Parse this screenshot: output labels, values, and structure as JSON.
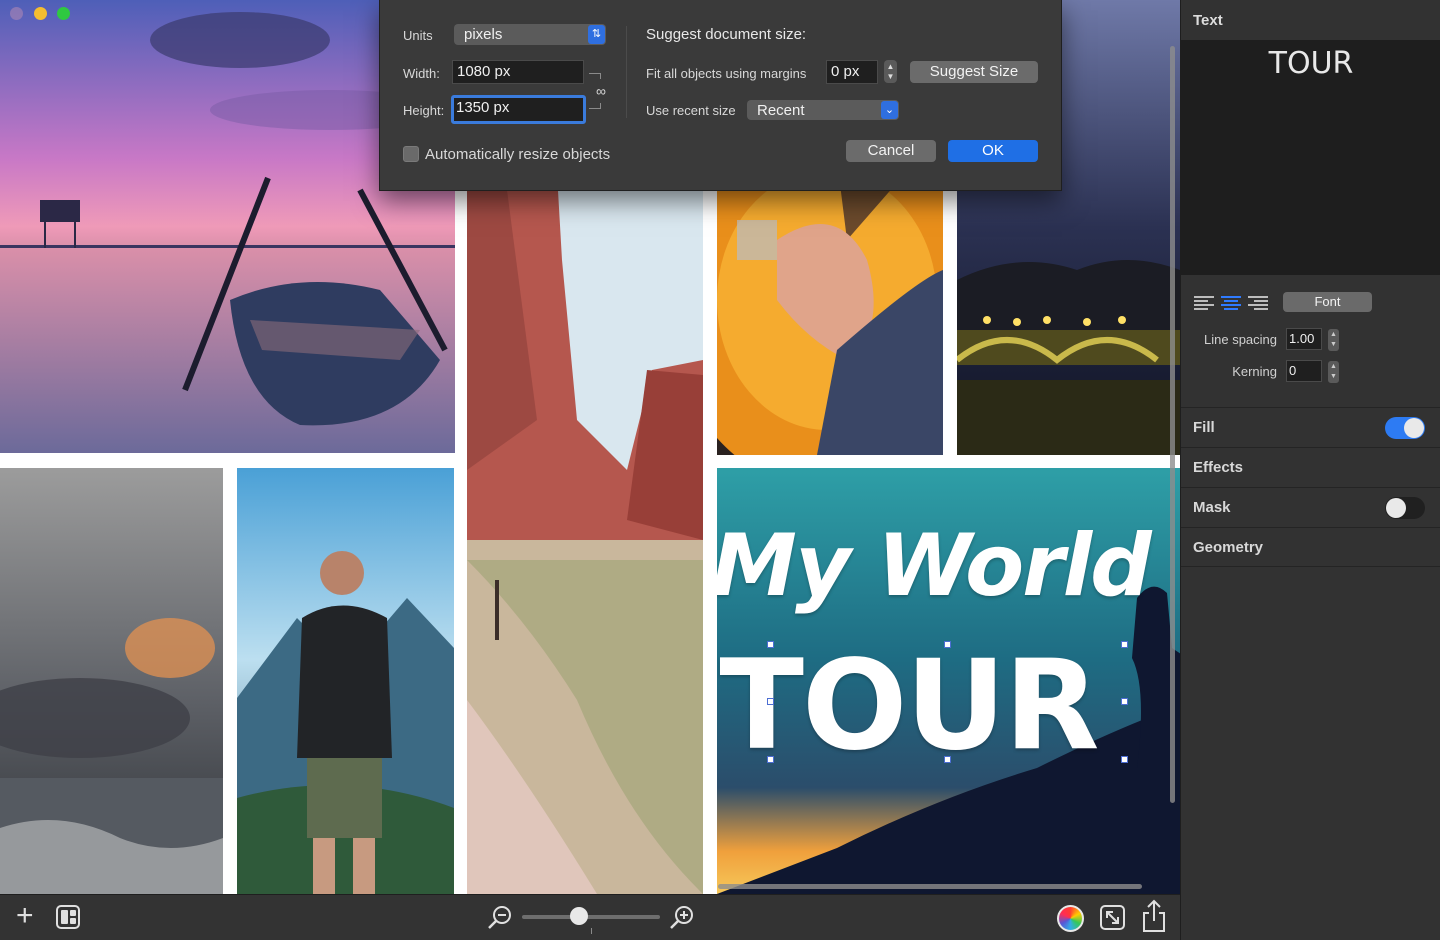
{
  "dialog": {
    "units_label": "Units",
    "units_value": "pixels",
    "width_label": "Width:",
    "width_value": "1080 px",
    "height_label": "Height:",
    "height_value": "1350 px",
    "suggest_heading": "Suggest document size:",
    "fit_label": "Fit all objects using margins",
    "margin_value": "0 px",
    "suggest_button": "Suggest Size",
    "recent_label": "Use recent size",
    "recent_value": "Recent",
    "auto_resize_label": "Automatically resize objects",
    "cancel_button": "Cancel",
    "ok_button": "OK"
  },
  "canvas": {
    "title_line_1": "My World",
    "title_line_2": "TOUR"
  },
  "inspector": {
    "header": "Text",
    "preview_text": "TOUR",
    "font_button": "Font",
    "line_spacing_label": "Line spacing",
    "line_spacing_value": "1.00",
    "kerning_label": "Kerning",
    "kerning_value": "0",
    "sections": {
      "fill": "Fill",
      "effects": "Effects",
      "mask": "Mask",
      "geometry": "Geometry"
    },
    "fill_enabled": true,
    "mask_enabled": false
  },
  "toolbar": {
    "zoom_level": 0.41,
    "icons": [
      "add-icon",
      "layout-icon",
      "zoom-out-icon",
      "zoom-in-icon",
      "color-picker-icon",
      "fit-icon",
      "share-icon"
    ]
  },
  "colors": {
    "accent": "#1f6fe5",
    "dialog_bg": "#3a3a3a",
    "inspector_bg": "#323232",
    "toolbar_bg": "#333333"
  }
}
